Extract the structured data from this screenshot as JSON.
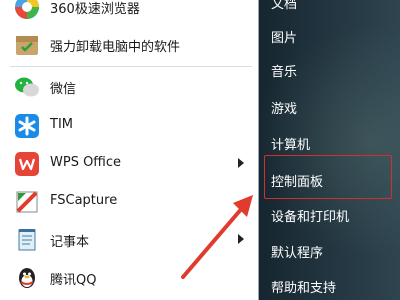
{
  "left_menu": {
    "items": [
      {
        "label": "360极速浏览器",
        "icon": "360-browser-icon"
      },
      {
        "label": "强力卸载电脑中的软件",
        "icon": "uninstall-box-icon"
      },
      {
        "label": "微信",
        "icon": "wechat-icon"
      },
      {
        "label": "TIM",
        "icon": "tim-icon"
      },
      {
        "label": "WPS Office",
        "icon": "wps-icon"
      },
      {
        "label": "FSCapture",
        "icon": "fscapture-icon"
      },
      {
        "label": "记事本",
        "icon": "notepad-icon"
      },
      {
        "label": "腾讯QQ",
        "icon": "qq-penguin-icon"
      }
    ]
  },
  "right_menu": {
    "items": [
      {
        "label": "文档"
      },
      {
        "label": "图片"
      },
      {
        "label": "音乐"
      },
      {
        "label": "游戏"
      },
      {
        "label": "计算机"
      },
      {
        "label": "控制面板"
      },
      {
        "label": "设备和打印机"
      },
      {
        "label": "默认程序"
      },
      {
        "label": "帮助和支持"
      }
    ]
  },
  "colors": {
    "highlight_border": "#d03030",
    "arrow": "#e03b2e"
  }
}
